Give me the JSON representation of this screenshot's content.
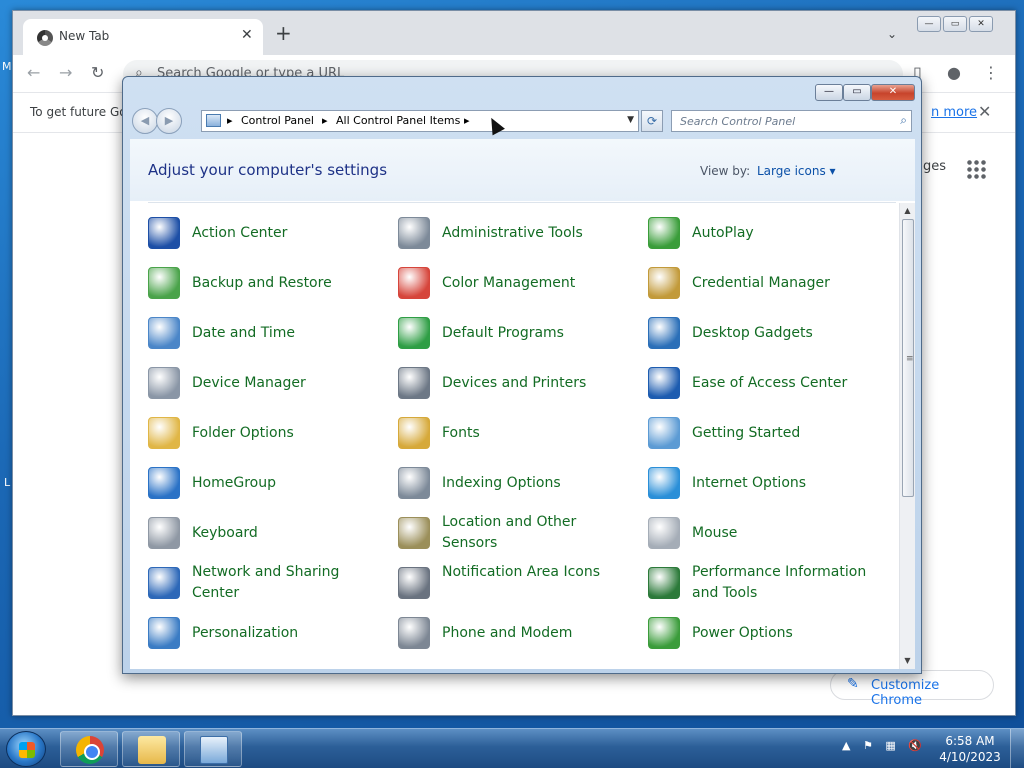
{
  "chrome": {
    "tab_title": "New Tab",
    "tab_close": "✕",
    "new_tab": "+",
    "tab_search": "⌄",
    "omnibox_placeholder": "Search Google or type a URL",
    "infobar_text": "To get future Go",
    "infobar_link": "n more",
    "infobar_close": "✕",
    "ntp_link_fragment": "ges",
    "customize_label": "Customize Chrome"
  },
  "desktop_fragments": [
    "M",
    "L"
  ],
  "control_panel": {
    "breadcrumbs": [
      "Control Panel",
      "All Control Panel Items"
    ],
    "search_placeholder": "Search Control Panel",
    "heading": "Adjust your computer's settings",
    "view_by_label": "View by:",
    "view_by_value": "Large icons ▾",
    "items": [
      {
        "label": "Action Center",
        "icon": "flag-icon",
        "color": "#1d4fa6"
      },
      {
        "label": "Administrative Tools",
        "icon": "gears-icon",
        "color": "#7d8a99"
      },
      {
        "label": "AutoPlay",
        "icon": "autoplay-icon",
        "color": "#3a9d3a"
      },
      {
        "label": "Backup and Restore",
        "icon": "backup-icon",
        "color": "#4aa34a"
      },
      {
        "label": "Color Management",
        "icon": "color-icon",
        "color": "#d6453b"
      },
      {
        "label": "Credential Manager",
        "icon": "safe-icon",
        "color": "#c29a3a"
      },
      {
        "label": "Date and Time",
        "icon": "calendar-icon",
        "color": "#4b86c8"
      },
      {
        "label": "Default Programs",
        "icon": "defaults-icon",
        "color": "#2f9e45"
      },
      {
        "label": "Desktop Gadgets",
        "icon": "gadgets-icon",
        "color": "#2b6fb8"
      },
      {
        "label": "Device Manager",
        "icon": "device-manager-icon",
        "color": "#8a96a6"
      },
      {
        "label": "Devices and Printers",
        "icon": "printer-icon",
        "color": "#6d7886"
      },
      {
        "label": "Ease of Access Center",
        "icon": "accessibility-icon",
        "color": "#1d5cb0"
      },
      {
        "label": "Folder Options",
        "icon": "folder-icon",
        "color": "#e0b646"
      },
      {
        "label": "Fonts",
        "icon": "fonts-icon",
        "color": "#d6a93a"
      },
      {
        "label": "Getting Started",
        "icon": "getting-started-icon",
        "color": "#5c9bd4"
      },
      {
        "label": "HomeGroup",
        "icon": "homegroup-icon",
        "color": "#2a72c6"
      },
      {
        "label": "Indexing Options",
        "icon": "magnifier-icon",
        "color": "#7d8a99"
      },
      {
        "label": "Internet Options",
        "icon": "globe-icon",
        "color": "#2a8fd8"
      },
      {
        "label": "Keyboard",
        "icon": "keyboard-icon",
        "color": "#8f98a4"
      },
      {
        "label": "Location and Other Sensors",
        "icon": "sensors-icon",
        "color": "#9b8f5a"
      },
      {
        "label": "Mouse",
        "icon": "mouse-icon",
        "color": "#a5adb7"
      },
      {
        "label": "Network and Sharing Center",
        "icon": "network-icon",
        "color": "#2d68b8"
      },
      {
        "label": "Notification Area Icons",
        "icon": "notification-icon",
        "color": "#6a7380"
      },
      {
        "label": "Performance Information and Tools",
        "icon": "performance-icon",
        "color": "#2c7a3a"
      },
      {
        "label": "Personalization",
        "icon": "personalization-icon",
        "color": "#3b7cc4"
      },
      {
        "label": "Phone and Modem",
        "icon": "phone-icon",
        "color": "#7d8794"
      },
      {
        "label": "Power Options",
        "icon": "battery-icon",
        "color": "#3b9c3b"
      }
    ]
  },
  "taskbar": {
    "time": "6:58 AM",
    "date": "4/10/2023",
    "tray_arrow": "▲"
  }
}
